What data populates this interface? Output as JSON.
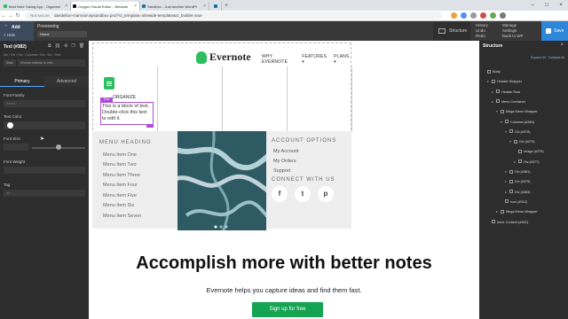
{
  "browser": {
    "tabs": [
      {
        "title": "Best Note Taking App - Organize",
        "favicon_color": "#2dbe60",
        "active": false
      },
      {
        "title": "Oxygen Visual Editor - Sitewide",
        "favicon_color": "#111111",
        "active": true
      },
      {
        "title": "Sandbox - Just another WordPr",
        "favicon_color": "#1d6fa5",
        "active": false
      },
      {
        "title": "",
        "favicon_color": "#1d6fa5",
        "active": false
      }
    ],
    "new_tab": "+",
    "url_prefix": "Not secure",
    "url": "dandelion-mamcwl.wpsandbox.pro/?ct_template=sitewide-template&ct_builder=true"
  },
  "oxygen_bar": {
    "add_label": "Add",
    "add_icon": "+",
    "hide_label": "< Hide",
    "previewing_label": "Previewing",
    "preview_value": "Home",
    "structure_label": "Structure",
    "history_label": "History",
    "undo_label": "Undo",
    "redo_label": "Redo",
    "manage_label": "Manage",
    "settings_label": "Settings",
    "backtowp_label": "Back to WP",
    "save_label": "Save"
  },
  "left_panel": {
    "title": "Text (#382)",
    "breadcrumb": "Div › Div › Div › Columns › Div › Div › Text",
    "state_label": "State",
    "selector_placeholder": "Choose selector to edit...",
    "tabs": [
      "Primary",
      "Advanced"
    ],
    "font_family_label": "Font Family",
    "font_family_value": "Inherit",
    "text_color_label": "Text Color",
    "font_size_label": "Font Size",
    "font_weight_label": "Font Weight",
    "tag_label": "Tag",
    "tag_value": "div"
  },
  "canvas": {
    "logo_text": "Evernote",
    "nav": [
      "WHY EVERNOTE",
      "FEATURES ▾",
      "PLANS ▾"
    ],
    "organize_text": "ORGANIZE",
    "selected_tag": "Text",
    "text_block": "This is a block of text. Double-click this text to edit it.",
    "menu_heading": "MENU HEADING",
    "menu_items": [
      "Menu Item One",
      "Menu Item Two",
      "Menu Item Three",
      "Menu Item Four",
      "Menu Item Five",
      "Menu Item Six",
      "Menu Item Seven"
    ],
    "account_heading": "ACCOUNT OPTIONS",
    "account_items": [
      "My Account",
      "My Orders",
      "Support"
    ],
    "connect_heading": "CONNECT WITH US",
    "social": [
      "f",
      "t",
      "p"
    ],
    "hero_title": "Accomplish more with better notes",
    "hero_sub": "Evernote helps you capture ideas and find them fast.",
    "cta": "Sign up for free"
  },
  "right_panel": {
    "title": "Structure",
    "links": "Expand All · Collapse All",
    "tree": [
      {
        "label": "Body",
        "depth": 0,
        "arrow": ""
      },
      {
        "label": "Header Wrapper",
        "depth": 1,
        "arrow": "▸"
      },
      {
        "label": "Header Row",
        "depth": 2,
        "arrow": "▸"
      },
      {
        "label": "Menu Container",
        "depth": 2,
        "arrow": "▸"
      },
      {
        "label": "Mega Menu Wrapper",
        "depth": 3,
        "arrow": "▾"
      },
      {
        "label": "Columns (#380)",
        "depth": 4,
        "arrow": "▾"
      },
      {
        "label": "Div (#378)",
        "depth": 5,
        "arrow": "▾"
      },
      {
        "label": "Div (#379)",
        "depth": 6,
        "arrow": "▾"
      },
      {
        "label": "Image (#376)",
        "depth": 7,
        "arrow": ""
      },
      {
        "label": "Div (#377)",
        "depth": 7,
        "arrow": "▸"
      },
      {
        "label": "Div (#381)",
        "depth": 5,
        "arrow": "▸"
      },
      {
        "label": "Div (#375)",
        "depth": 5,
        "arrow": "▸"
      },
      {
        "label": "Div (#383)",
        "depth": 5,
        "arrow": "▸"
      },
      {
        "label": "Icon (#312)",
        "depth": 4,
        "arrow": ""
      },
      {
        "label": "Mega Menu Wrapper",
        "depth": 3,
        "arrow": "▸"
      },
      {
        "label": "Inner Content (#262)",
        "depth": 1,
        "arrow": ""
      }
    ]
  },
  "colors": {
    "evernote_green": "#2dbe60",
    "cta_green": "#14a452",
    "oxygen_blue": "#2d86d8",
    "selection_purple": "#b04bd6"
  }
}
